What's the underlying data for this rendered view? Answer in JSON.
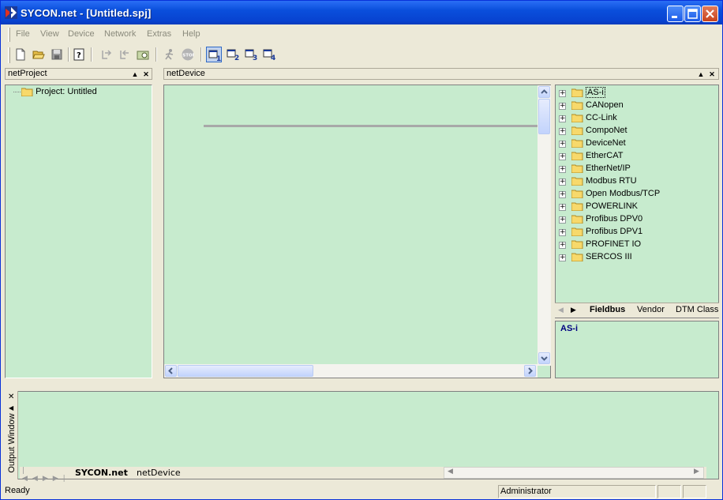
{
  "window": {
    "title": "SYCON.net - [Untitled.spj]"
  },
  "menu": [
    "File",
    "View",
    "Device",
    "Network",
    "Extras",
    "Help"
  ],
  "toolbar": {
    "icons": [
      "new-document-icon",
      "open-folder-icon",
      "save-icon",
      "help-icon",
      "connect-icon",
      "disconnect-icon",
      "scan-icon",
      "run-icon",
      "stop-icon",
      "view-1-icon",
      "view-2-icon",
      "view-3-icon",
      "view-4-icon"
    ],
    "active": "view-1-icon",
    "view_numbers": [
      "1",
      "2",
      "3",
      "4"
    ]
  },
  "net_project": {
    "title": "netProject",
    "root": "Project: Untitled"
  },
  "net_device": {
    "title": "netDevice"
  },
  "catalog": {
    "items": [
      "AS-i",
      "CANopen",
      "CC-Link",
      "CompoNet",
      "DeviceNet",
      "EtherCAT",
      "EtherNet/IP",
      "Modbus RTU",
      "Open Modbus/TCP",
      "POWERLINK",
      "Profibus DPV0",
      "Profibus DPV1",
      "PROFINET IO",
      "SERCOS III"
    ],
    "selected": "AS-i",
    "tabs": [
      "Fieldbus",
      "Vendor",
      "DTM Class"
    ],
    "active_tab": "Fieldbus"
  },
  "description": {
    "text": "AS-i"
  },
  "output": {
    "title": "Output Window",
    "tabs": [
      "SYCON.net",
      "netDevice"
    ],
    "active_tab": "SYCON.net"
  },
  "status": {
    "text": "Ready",
    "user": "Administrator"
  },
  "colors": {
    "panel_green": "#c7ebce",
    "titlebar_blue": "#0a4fdc",
    "chrome": "#ece9d8",
    "selected_text": "#000080"
  }
}
